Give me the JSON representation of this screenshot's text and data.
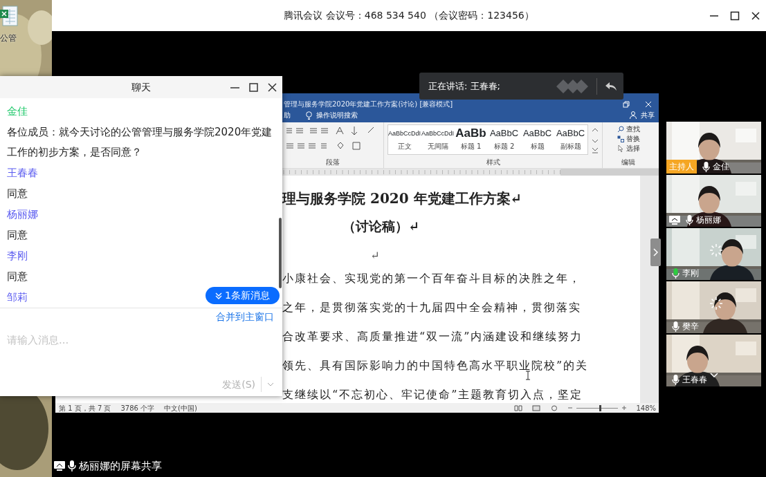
{
  "desktop": {
    "icon_label": "公管"
  },
  "meeting_window": {
    "title": "腾讯会议 会议号：468 534 540 （会议密码：123456）"
  },
  "shared_screen": {
    "window_title": "管理与服务学院2020年党建工作方案(讨论) [兼容模式]",
    "tabs": [
      "助",
      "操作说明搜索"
    ],
    "share": "共享",
    "styles": [
      {
        "sample": "AaBbCcDdI",
        "name": "正文",
        "kind": "body"
      },
      {
        "sample": "AaBbCcDdI",
        "name": "无间隔",
        "kind": "body"
      },
      {
        "sample": "AaBb",
        "name": "标题 1",
        "kind": "heading1"
      },
      {
        "sample": "AaBbC",
        "name": "标题 2",
        "kind": "heading"
      },
      {
        "sample": "AaBbC",
        "name": "标题",
        "kind": "heading"
      },
      {
        "sample": "AaBbC",
        "name": "副标题",
        "kind": "heading"
      }
    ],
    "groups": [
      "段落",
      "样式",
      "编辑"
    ],
    "editing": [
      "查找",
      "替换",
      "选择"
    ],
    "document": {
      "title": "理与服务学院 2020 年党建工作方案↵",
      "subtitle": "（讨论稿）↵",
      "empty_mark": "↵",
      "lines": [
        "小康社会、实现党的第一个百年奋斗目标的决胜之年，",
        "之年，是贯彻落实党的十九届四中全会精神，贯彻落实",
        "合改革要求、高质量推进“双一流”内涵建设和继续努力",
        "领先、具有国际影响力的中国特色高水平职业院校”的关",
        "支继续以“不忘初心、牢记使命”主题教育切入点，坚定"
      ]
    },
    "status": {
      "page": "第 1 页，共 7 页",
      "words": "3786 个字",
      "language": "中文(中国)",
      "zoom": "148%",
      "zoom_slider": {
        "level": 0.57
      }
    }
  },
  "speaking_banner": {
    "label": "正在讲话: 王春春;"
  },
  "participants": [
    {
      "name": "金佳",
      "badge": "主持人",
      "sharing": false,
      "speaking": false,
      "loading": false
    },
    {
      "name": "杨丽娜",
      "sharing": true,
      "speaking": false,
      "loading": false
    },
    {
      "name": "李刚",
      "sharing": false,
      "speaking": true,
      "loading": true
    },
    {
      "name": "樊辛",
      "sharing": false,
      "speaking": false,
      "loading": true
    },
    {
      "name": "王春春",
      "sharing": false,
      "speaking": false,
      "loading": false
    }
  ],
  "screen_share_label": "杨丽娜的屏幕共享",
  "chat": {
    "title": "聊天",
    "messages": [
      {
        "sender": "金佳",
        "color": "#1ec86a",
        "text": "各位成员：就今天讨论的公管管理与服务学院2020年党建工作的初步方案，是否同意？"
      },
      {
        "sender": "王春春",
        "color": "#5b5cf0",
        "text": "同意"
      },
      {
        "sender": "杨丽娜",
        "color": "#5b5cf0",
        "text": "同意"
      },
      {
        "sender": "李刚",
        "color": "#5b5cf0",
        "text": "同意"
      },
      {
        "sender": "邹莉",
        "color": "#5b5cf0"
      }
    ],
    "new_messages": "1条新消息",
    "merge_link": "合并到主窗口",
    "placeholder": "请输入消息...",
    "send": {
      "label": "发送(S)",
      "disabled": true
    }
  }
}
